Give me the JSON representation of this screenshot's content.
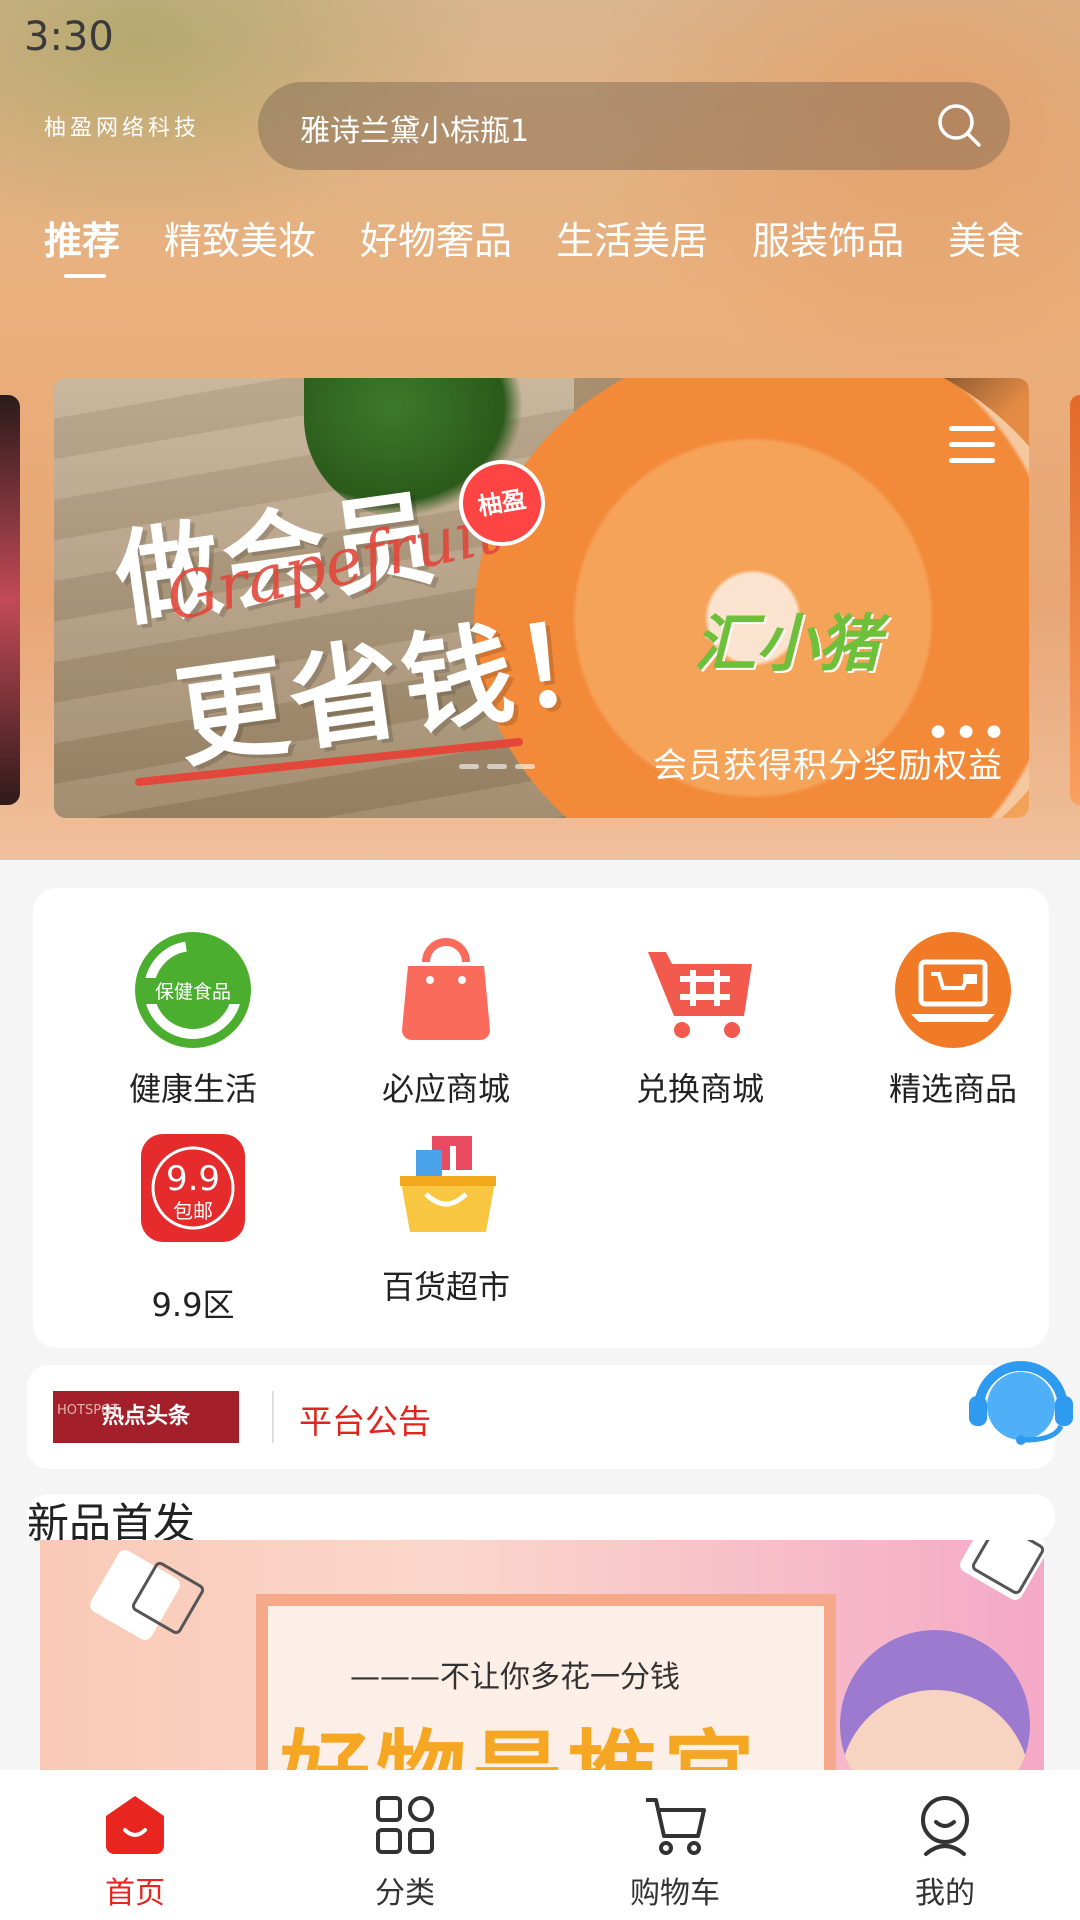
{
  "status": {
    "time": "3:30"
  },
  "header": {
    "brand": "柚盈网络科技",
    "search_placeholder": "雅诗兰黛小棕瓶1",
    "tabs": [
      {
        "label": "推荐",
        "active": true
      },
      {
        "label": "精致美妆"
      },
      {
        "label": "好物奢品"
      },
      {
        "label": "生活美居"
      },
      {
        "label": "服装饰品"
      },
      {
        "label": "美食"
      }
    ]
  },
  "banner": {
    "line1": "做会员",
    "line2": "更省钱！",
    "script": "Grapefruit",
    "badge": "柚盈",
    "brand": "汇小猪",
    "caption": "会员获得积分奖励权益"
  },
  "categories": [
    {
      "label": "健康生活",
      "icon": "health-food-icon",
      "badge": "保健食品"
    },
    {
      "label": "必应商城",
      "icon": "shopping-bag-icon"
    },
    {
      "label": "兑换商城",
      "icon": "cart-icon"
    },
    {
      "label": "精选商品",
      "icon": "laptop-shop-icon"
    },
    {
      "label": "9.9区",
      "icon": "price-tag-icon",
      "badge_top": "9.9",
      "badge_bottom": "包邮"
    },
    {
      "label": "百货超市",
      "icon": "gift-basket-icon"
    }
  ],
  "notice": {
    "logo_text": "热点头条",
    "logo_small": "HOTSPOT",
    "text": "平台公告"
  },
  "new_products": {
    "title": "新品首发",
    "slogan": "———不让你多花一分钱",
    "headline": "好物是推官"
  },
  "bottom_nav": [
    {
      "label": "首页",
      "icon": "home-icon",
      "active": true
    },
    {
      "label": "分类",
      "icon": "grid-icon"
    },
    {
      "label": "购物车",
      "icon": "cart-outline-icon"
    },
    {
      "label": "我的",
      "icon": "profile-icon"
    }
  ],
  "colors": {
    "accent": "#e8261f",
    "tab_text": "#ffffff",
    "notice_text": "#e0261c"
  }
}
